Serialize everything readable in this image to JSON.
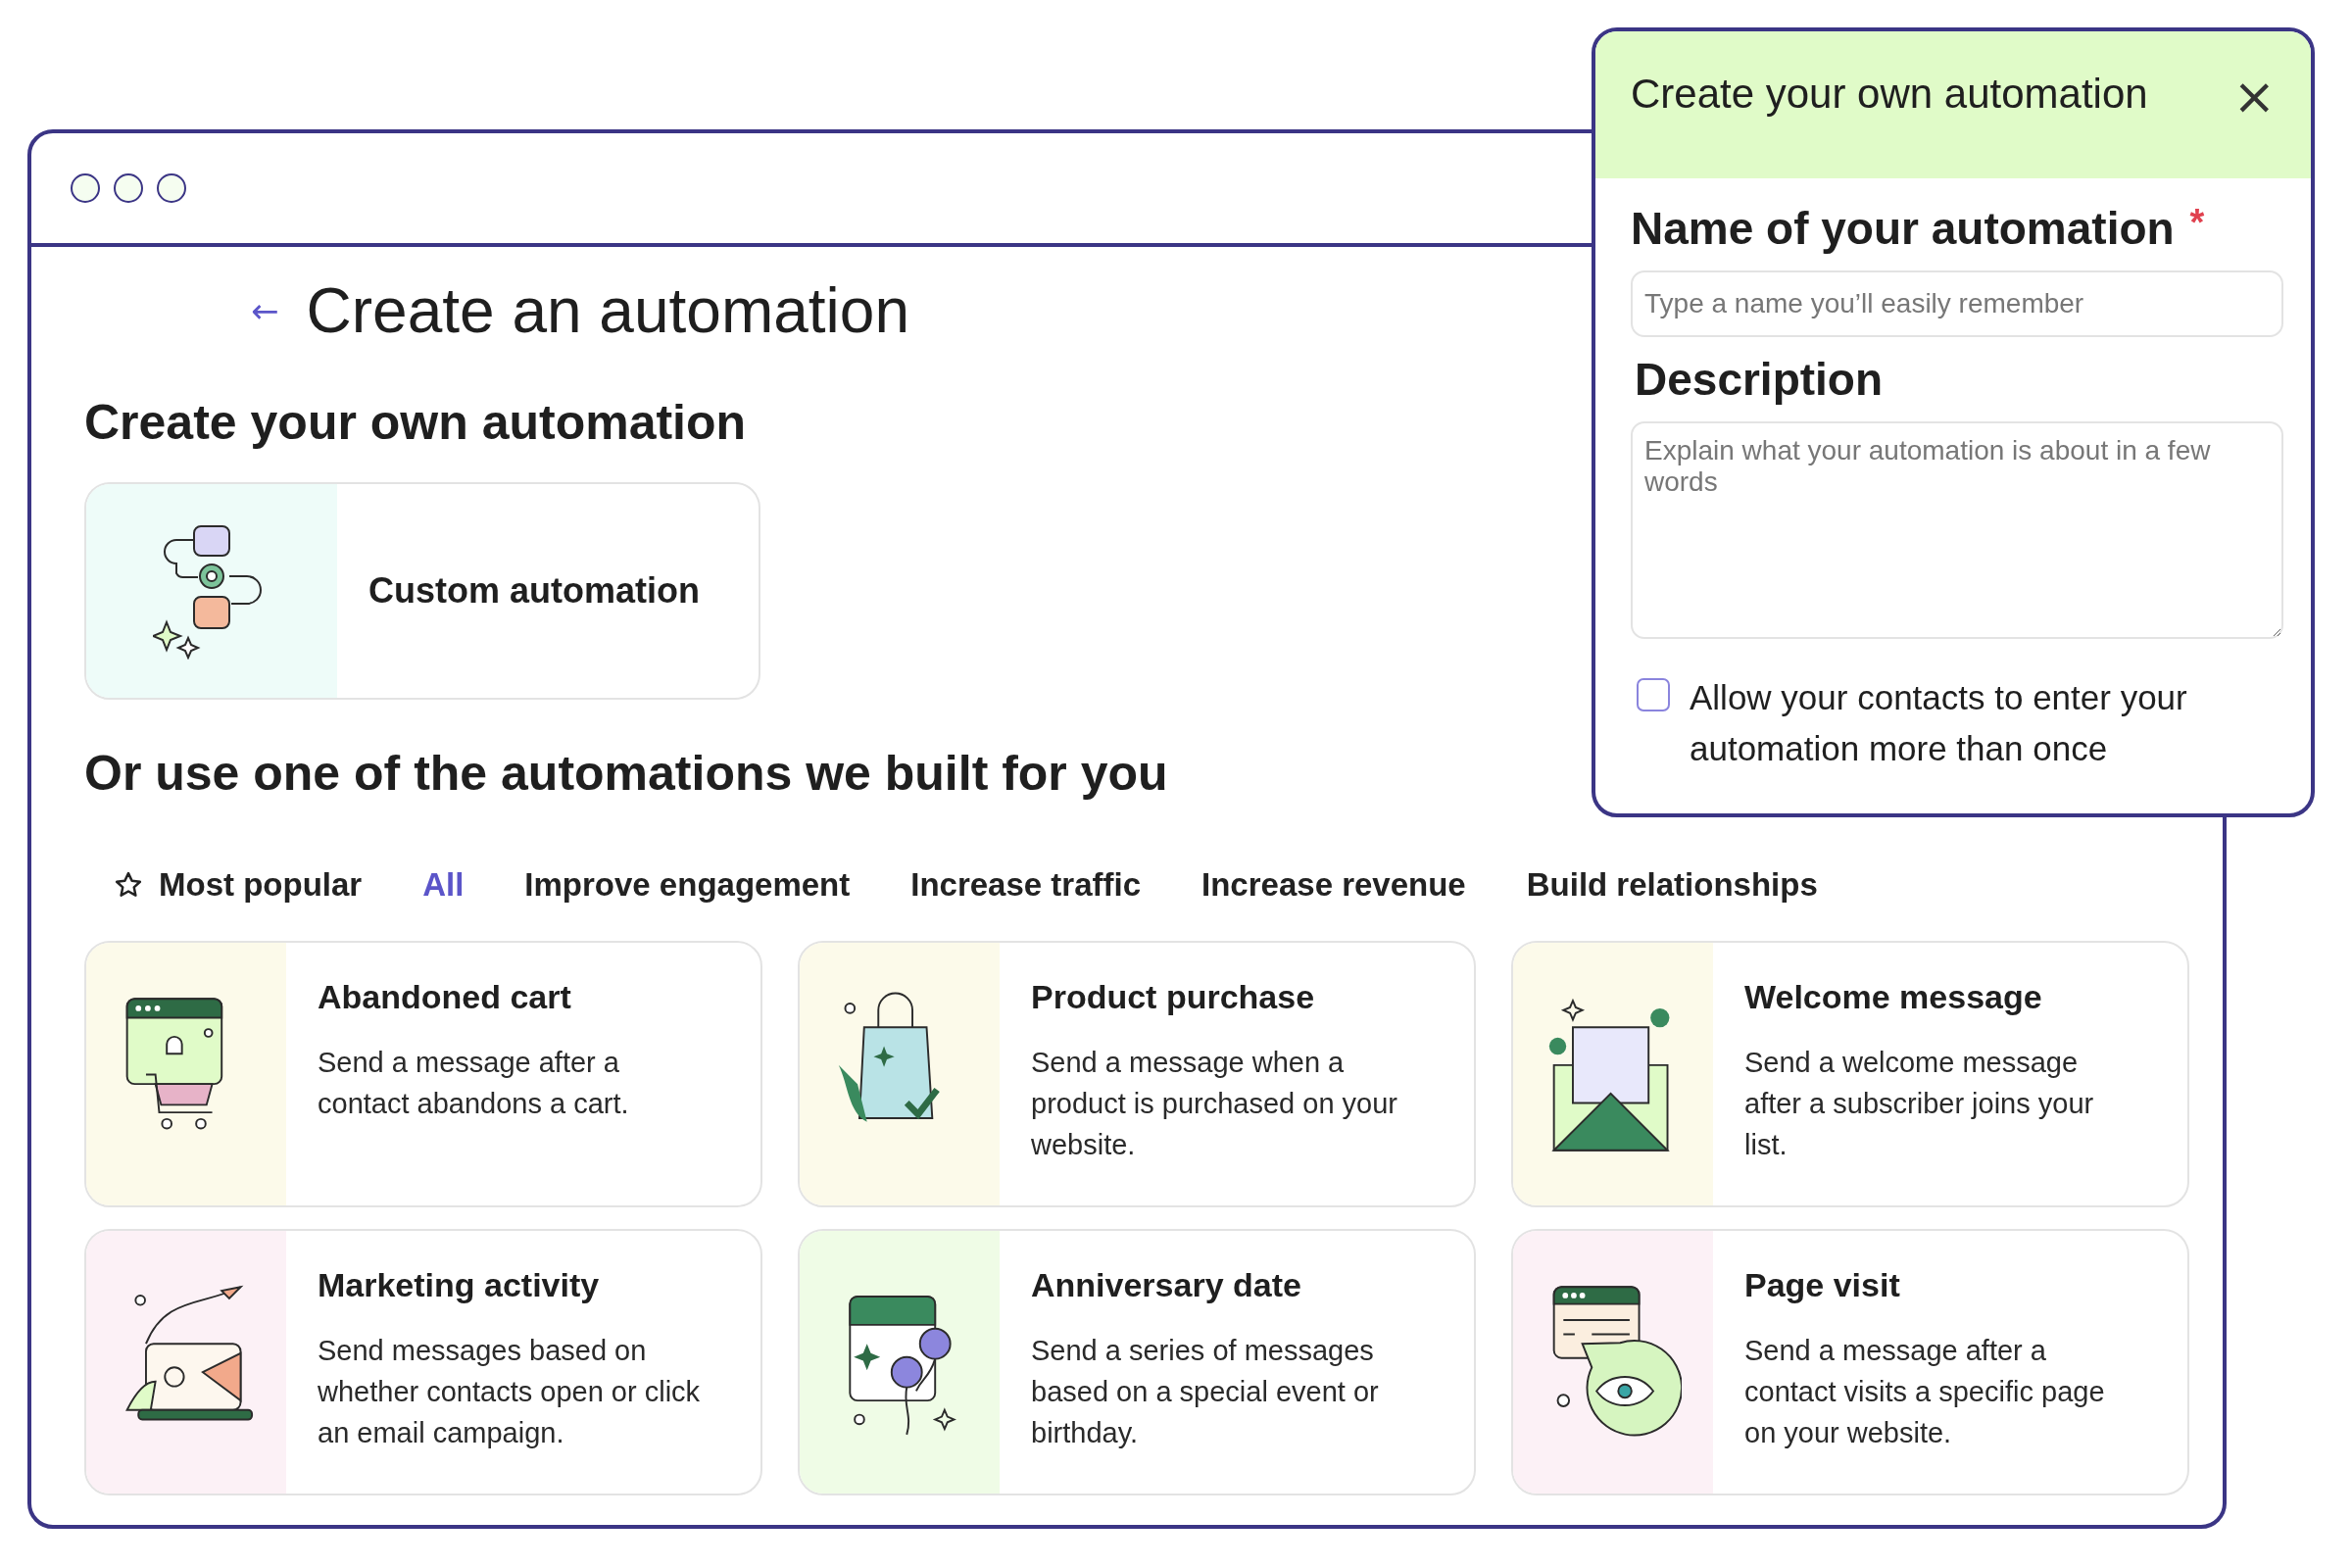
{
  "window": {
    "back": "←",
    "title": "Create an automation"
  },
  "own_section": {
    "heading": "Create your own automation",
    "card": {
      "label": "Custom automation"
    }
  },
  "builtin_section": {
    "heading": "Or use one of the automations we built for you"
  },
  "tabs": [
    {
      "label": "Most popular",
      "kind": "star",
      "selected": false
    },
    {
      "label": "All",
      "kind": "plain",
      "selected": true
    },
    {
      "label": "Improve engagement",
      "kind": "plain",
      "selected": false
    },
    {
      "label": "Increase traffic",
      "kind": "plain",
      "selected": false
    },
    {
      "label": "Increase revenue",
      "kind": "plain",
      "selected": false
    },
    {
      "label": "Build relationships",
      "kind": "plain",
      "selected": false
    }
  ],
  "cards": [
    {
      "kind": "cart",
      "title": "Abandoned cart",
      "description": "Send a message after a contact abandons a cart."
    },
    {
      "kind": "bag",
      "title": "Product purchase",
      "description": "Send a message when a product is purchased on your website."
    },
    {
      "kind": "envelope",
      "title": "Welcome message",
      "description": "Send a welcome message after a subscriber joins your list."
    },
    {
      "kind": "megaphone",
      "title": "Marketing activity",
      "description": "Send messages based on whether contacts open or click an email campaign."
    },
    {
      "kind": "calendar",
      "title": "Anniversary date",
      "description": "Send a series of messages based on a special event or birthday."
    },
    {
      "kind": "eye",
      "title": "Page visit",
      "description": "Send a message after a contact visits a specific page on your website."
    }
  ],
  "panel": {
    "title": "Create your own automation",
    "close": "×",
    "name_label": "Name of your automation",
    "required_mark": "*",
    "name_placeholder": "Type a name you’ll easily remember",
    "description_label": "Description",
    "description_placeholder": "Explain what your automation is about in a few words",
    "checkbox": {
      "label": "Allow your contacts to enter your automation more than once",
      "checked": false
    }
  }
}
